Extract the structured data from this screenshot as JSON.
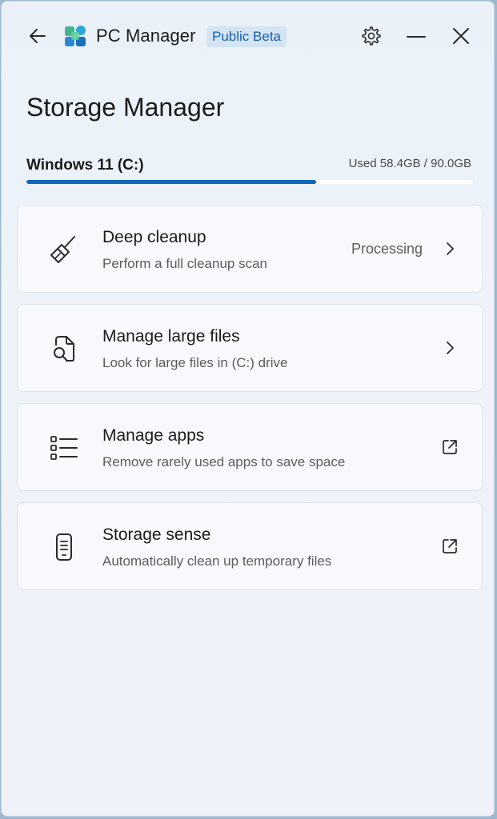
{
  "app": {
    "title": "PC Manager",
    "badge": "Public Beta"
  },
  "page": {
    "title": "Storage Manager"
  },
  "drive": {
    "name": "Windows 11 (C:)",
    "usage_text": "Used 58.4GB / 90.0GB",
    "used_fraction": 0.649
  },
  "cards": [
    {
      "title": "Deep cleanup",
      "description": "Perform a full cleanup scan",
      "status": "Processing",
      "icon": "broom-icon",
      "action_icon": "chevron-right-icon"
    },
    {
      "title": "Manage large files",
      "description": "Look for large files in (C:) drive",
      "status": "",
      "icon": "file-search-icon",
      "action_icon": "chevron-right-icon"
    },
    {
      "title": "Manage apps",
      "description": "Remove rarely used apps to save space",
      "status": "",
      "icon": "list-icon",
      "action_icon": "external-link-icon"
    },
    {
      "title": "Storage sense",
      "description": "Automatically clean up temporary files",
      "status": "",
      "icon": "phone-storage-icon",
      "action_icon": "external-link-icon"
    }
  ],
  "colors": {
    "accent": "#1466b8",
    "badge_bg": "#d4e4f4",
    "badge_text": "#1a5fa8"
  }
}
